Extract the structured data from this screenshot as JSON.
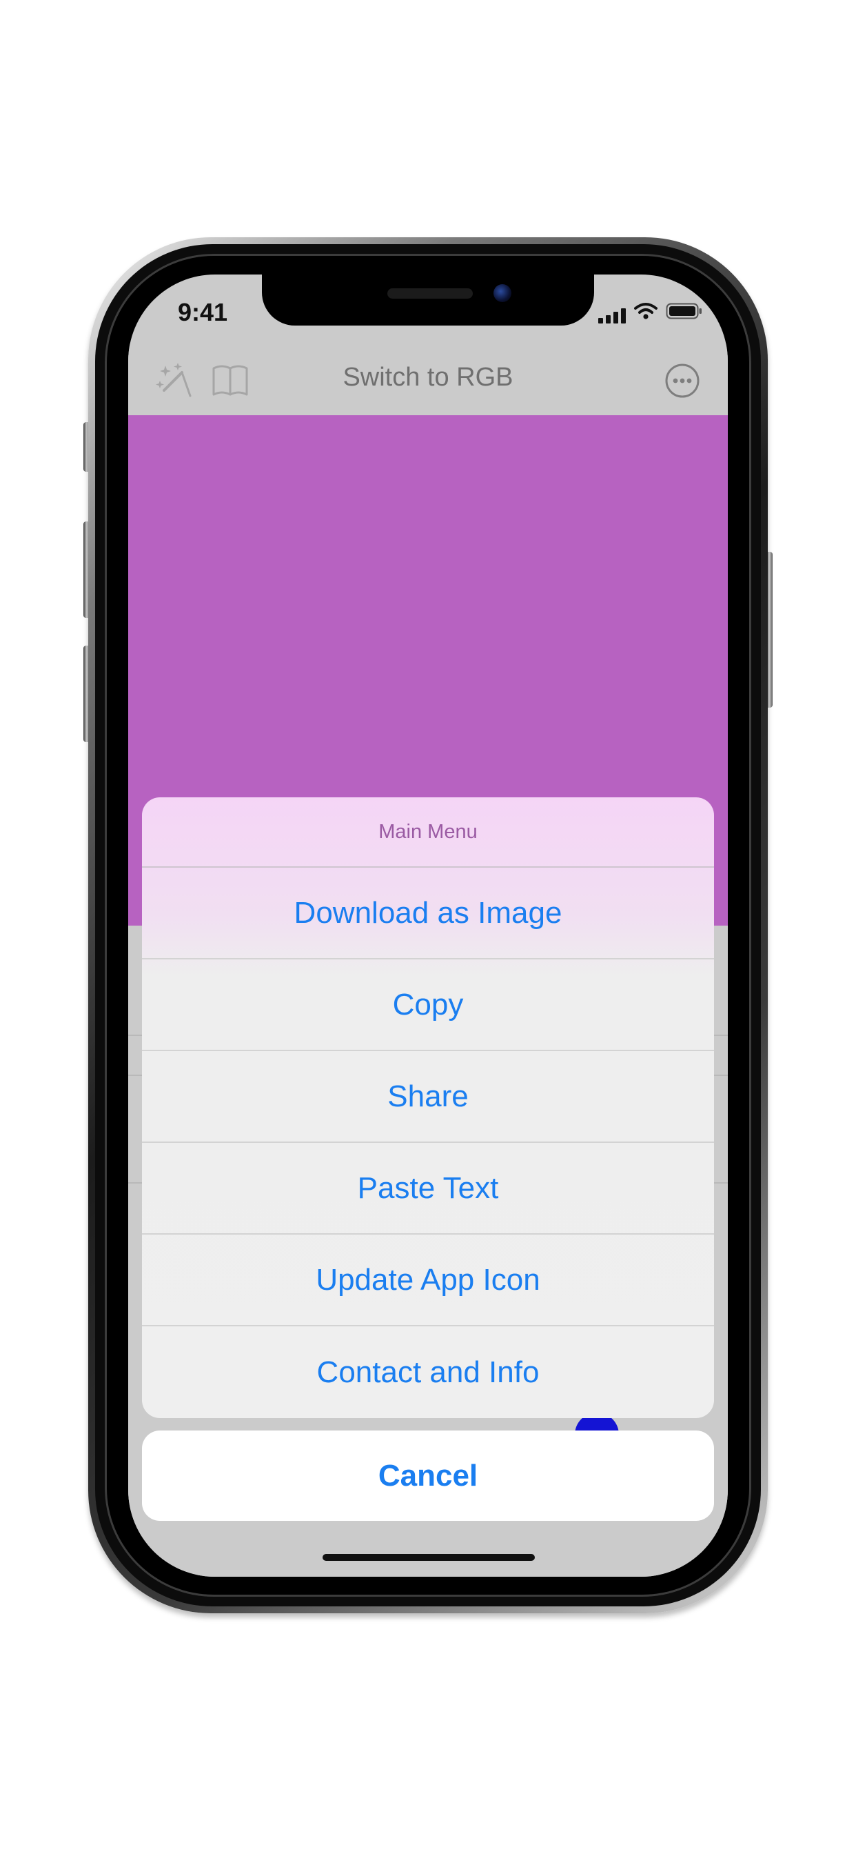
{
  "status_bar": {
    "time": "9:41"
  },
  "nav_bar": {
    "title": "Switch to RGB",
    "left_icons": [
      "magic-wand-icon",
      "book-icon"
    ],
    "right_icon": "more-ellipsis-icon"
  },
  "canvas": {
    "color": "#b762c1"
  },
  "action_sheet": {
    "title": "Main Menu",
    "items": [
      {
        "label": "Download as Image"
      },
      {
        "label": "Copy"
      },
      {
        "label": "Share"
      },
      {
        "label": "Paste Text"
      },
      {
        "label": "Update App Icon"
      },
      {
        "label": "Contact and Info"
      }
    ],
    "cancel_label": "Cancel"
  },
  "colors": {
    "accent": "#1a7ef0",
    "sheet_title": "#9a5aa3",
    "nav_background": "#cbcbcb",
    "knob": "#1414d4"
  }
}
